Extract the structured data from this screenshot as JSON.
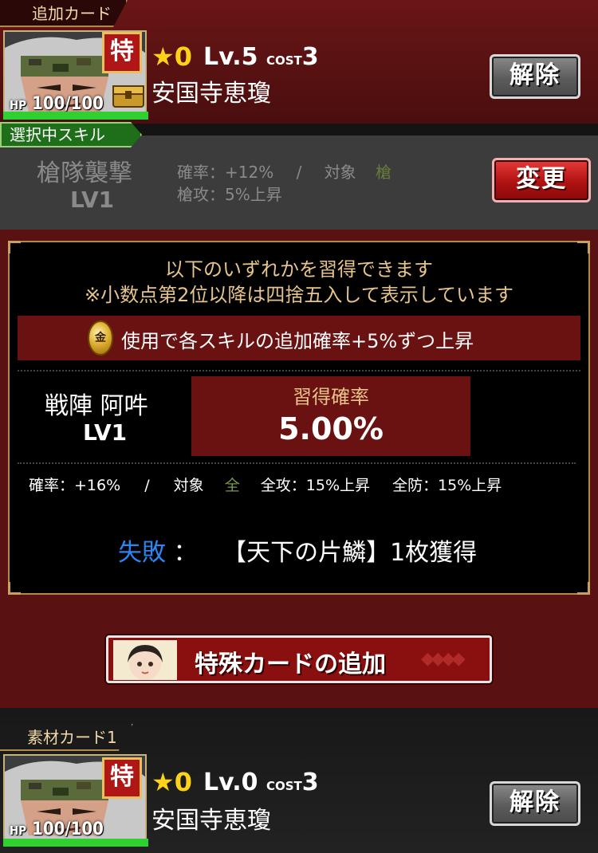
{
  "top_card": {
    "section_label": "追加カード",
    "toku_badge": "特",
    "hp_label": "HP",
    "hp_value": "100/100",
    "star_count": "0",
    "level": "Lv.5",
    "cost_label": "COST",
    "cost_value": "3",
    "name": "安国寺恵瓊",
    "release_button": "解除",
    "progress_hp": 1.0
  },
  "selected_skill": {
    "label": "選択中スキル",
    "name": "槍隊襲撃",
    "level": "LV1",
    "desc_line1_prefix": "確率：+12%",
    "desc_line1_sep": "/",
    "desc_line1_target_label": "対象",
    "desc_line1_target": "槍",
    "desc_line2": "槍攻：5%上昇",
    "change_button": "変更"
  },
  "panel": {
    "heading": "以下のいずれかを習得できます",
    "note": "※小数点第2位以降は四捨五入して表示しています",
    "coin_glyph": "金",
    "bonus_text": "使用で各スキルの追加確率+5%ずつ上昇",
    "skill_name": "戦陣 阿吽",
    "skill_level": "LV1",
    "rate_label": "習得確率",
    "rate_value": "5.00%",
    "detail_rate": "確率：+16%",
    "detail_sep": "/",
    "detail_target_label": "対象",
    "detail_target": "全",
    "detail_atk": "全攻：15%上昇",
    "detail_def": "全防：15%上昇",
    "fail_label": "失敗",
    "fail_colon": "：",
    "fail_text": "【天下の片鱗】1枚獲得"
  },
  "special_button": {
    "label": "特殊カードの追加",
    "diamonds": "◆◆◆◆"
  },
  "bottom_card": {
    "section_label": "素材カード1",
    "toku_badge": "特",
    "hp_label": "HP",
    "hp_value": "100/100",
    "star_count": "0",
    "level": "Lv.0",
    "cost_label": "COST",
    "cost_value": "3",
    "name": "安国寺恵瓊",
    "release_button": "解除",
    "progress_hp": 1.0
  },
  "colors": {
    "maroon": "#5a1111",
    "gold": "#e6c48a",
    "fail_blue": "#2a86f0",
    "target_green": "#7a9a4a",
    "hp_green": "#2fd02f",
    "star_yellow": "#ffd21a"
  },
  "icons": [
    "portrait-icon",
    "toku-badge-icon",
    "treasure-chest-icon",
    "gold-coin-icon",
    "girl-portrait-icon",
    "star-icon"
  ]
}
